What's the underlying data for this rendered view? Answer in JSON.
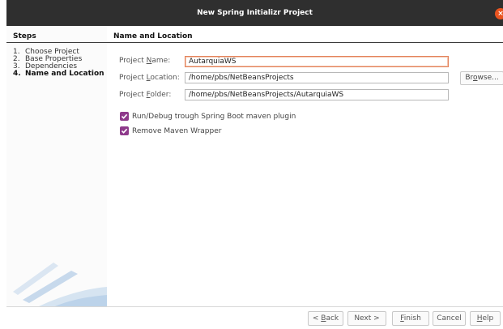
{
  "window": {
    "title": "New Spring Initializr Project",
    "close_glyph": "×"
  },
  "steps": {
    "heading": "Steps",
    "items": [
      {
        "num": "1.",
        "label": "Choose Project"
      },
      {
        "num": "2.",
        "label": "Base Properties"
      },
      {
        "num": "3.",
        "label": "Dependencies"
      },
      {
        "num": "4.",
        "label": "Name and Location"
      }
    ],
    "current_index": 3
  },
  "panel": {
    "heading": "Name and Location"
  },
  "form": {
    "project_name": {
      "label_pre": "Project ",
      "label_mn": "N",
      "label_post": "ame:",
      "value": "AutarquiaWS"
    },
    "project_location": {
      "label_pre": "Project ",
      "label_mn": "L",
      "label_post": "ocation:",
      "value": "/home/pbs/NetBeansProjects"
    },
    "project_folder": {
      "label_pre": "Project ",
      "label_mn": "F",
      "label_post": "older:",
      "value": "/home/pbs/NetBeansProjects/AutarquiaWS"
    },
    "browse_button": {
      "pre": "Br",
      "mn": "o",
      "post": "wse..."
    }
  },
  "options": {
    "run_debug": {
      "label": "Run/Debug trough Spring Boot maven plugin",
      "checked": true
    },
    "remove_wrapper": {
      "label": "Remove Maven Wrapper",
      "checked": true
    }
  },
  "footer": {
    "back": {
      "pre": "< ",
      "mn": "B",
      "post": "ack"
    },
    "next": {
      "label": "Next >"
    },
    "finish": {
      "pre": "",
      "mn": "F",
      "post": "inish"
    },
    "cancel": {
      "label": "Cancel"
    },
    "help": {
      "pre": "",
      "mn": "H",
      "post": "elp"
    }
  },
  "colors": {
    "checkbox_accent": "#8e3a8b",
    "focus_border": "#e3825a",
    "title_bar": "#2f2f2f",
    "close_button": "#e95420"
  }
}
